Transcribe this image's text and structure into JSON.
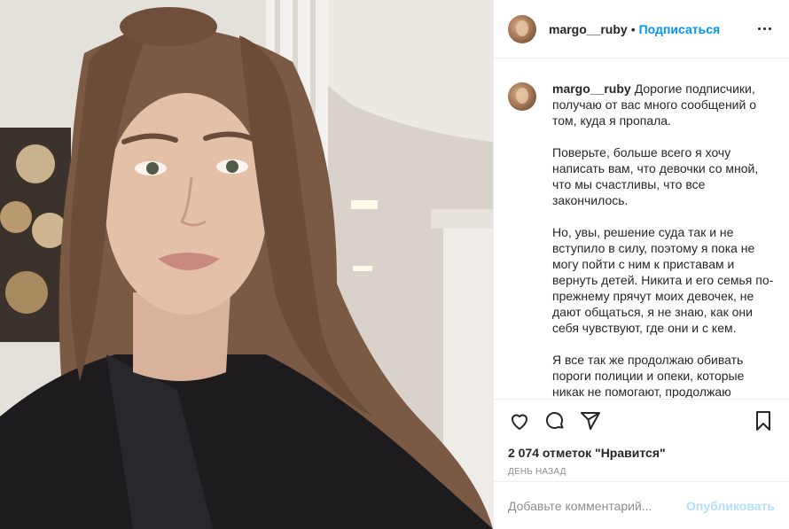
{
  "header": {
    "username": "margo__ruby",
    "separator": "•",
    "follow_label": "Подписаться",
    "more_icon": "more-options-icon"
  },
  "caption": {
    "username": "margo__ruby",
    "paragraphs": [
      "Дорогие подписчики, получаю от вас много сообщений о том, куда я пропала.",
      "Поверьте, больше всего я хочу написать вам, что девочки со мной, что мы счастливы, что все закончилось.",
      "Но, увы, решение суда так и не вступило в силу, поэтому я пока не могу пойти с ним к приставам и вернуть детей. Никита и его семья по-прежнему прячут моих девочек, не дают общаться, я не знаю, как они себя чувствуют, где они и с кем.",
      "Я все так же продолжаю обивать пороги полиции и опеки, которые никак не помогают, продолжаю"
    ]
  },
  "actions": {
    "icons": [
      "heart-icon",
      "comment-icon",
      "share-icon",
      "bookmark-icon"
    ],
    "likes": "2 074 отметок \"Нравится\"",
    "time": "ДЕНЬ НАЗАД"
  },
  "add_comment": {
    "placeholder": "Добавьте комментарий...",
    "publish_label": "Опубликовать"
  },
  "colors": {
    "accent": "#0095f6",
    "publish_disabled": "#b2dffc",
    "muted": "#8e8e8e",
    "border": "#efefef"
  }
}
